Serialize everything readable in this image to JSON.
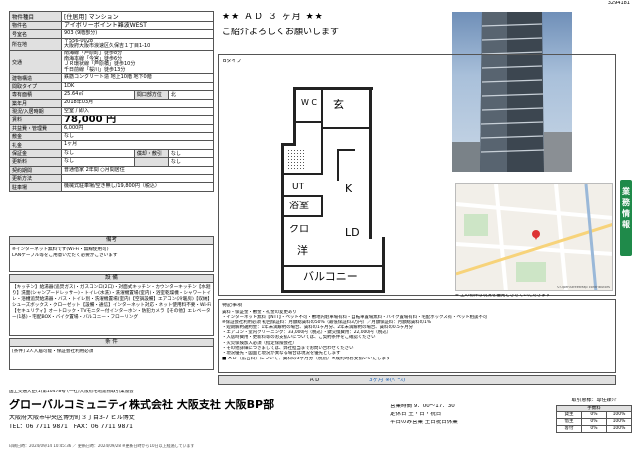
{
  "doc_number": "3294181",
  "header": {
    "category_label": "物件種目",
    "category_value": "[住居用] マンション",
    "tagline": "★★ ＡＤ ３ ヶ月 ★★",
    "greeting": "ご紹介よろしくお願いします"
  },
  "property_rows": [
    {
      "k": "物件名",
      "v": "アイボリーポイント難波WEST"
    },
    {
      "k": "号室名",
      "v": "903 (9階部分)"
    },
    {
      "k": "所在地",
      "v": "〒556-0028\n大阪府大阪市浪速区久保吉１丁目1-10"
    },
    {
      "k": "交通",
      "v": "南海線「芦原町」徒歩8分\n南海本線「今宮」徒歩6分\nＪＲ環状線「芦原橋」徒歩10分\n千日前線「桜川」徒歩13分"
    },
    {
      "k": "建物構造",
      "v": "鉄筋コンクリート造 地上10階 地下0階"
    },
    {
      "k": "間取タイプ",
      "v": "1DK"
    },
    {
      "k": "専有面積",
      "v": "25.64㎡",
      "k2": "間口部方位",
      "v2": "北"
    },
    {
      "k": "築年月",
      "v": "2018年03月"
    },
    {
      "k": "現況/入居時期",
      "v": "空室 / 即入"
    },
    {
      "k": "賃料",
      "v": "78,000 円"
    },
    {
      "k": "共益費・管理費",
      "v": "6,000円"
    },
    {
      "k": "敷金",
      "v": "なし"
    },
    {
      "k": "礼金",
      "v": "1ヶ月"
    },
    {
      "k": "保証金",
      "v": "なし",
      "k2": "償却・敷引",
      "v2": "なし"
    },
    {
      "k": "更新料",
      "v": "なし",
      "k2": "",
      "v2": "なし"
    },
    {
      "k": "契約期間",
      "v": "普通借家 2年間 ○月間居住"
    },
    {
      "k": "更新方法",
      "v": ""
    },
    {
      "k": "駐車場",
      "v": "機械式駐車場/空き無し/19,800円（税込）"
    }
  ],
  "remarks": {
    "label": "備考",
    "lines": [
      "※インターネット無料です(Wi-Fi・無線使用可)",
      "LANケーブル等をご用意いただく必要がございます"
    ]
  },
  "facilities": {
    "label": "設 備",
    "text": "【キッチン】給湯器(追焚ガス)・ガスコンロ(2口)・対面式キッチン・カウンターキッチン【水廻り】洗面(シャンプードレッサー)・トイレ(水洗)・洗濯機置場(室内)・浴室乾燥機・シャワートイレ・浴槽追焚給湯器・バス・トイレ別・洗濯機置場(室内)【空調設備】エアコン(冷暖房)【収納】シューズボックス・クローゼット【設備・通信】インターネット対応・ネット使用料不要・Wi-Fi【セキュリティ】オートロック・TVモニター付インターホン・防犯カメラ【その他】エレベーター(1基)・宅配BOX・バイク置場・バルコニー・フローリング"
  },
  "conditions": {
    "label": "条 件",
    "text": "[条件] 2人入居可能・保証会社利用必須"
  },
  "floorplan": {
    "type_label": "Bタイプ",
    "rooms": {
      "wc": "W C",
      "entry": "玄",
      "ut": "UT",
      "k": "K",
      "bath": "浴室",
      "closet": "クロ",
      "ld": "LD",
      "western": "洋",
      "balcony": "バルコニー"
    },
    "caption": "※ 上の物件は現況を優先とさせていただきます"
  },
  "side_tab": "業務情報",
  "notes": {
    "label": "特記事項",
    "lines": [
      "賃料・保証金・敷金・礼金の変更あり",
      "・インターネット無料【NTT】・ペット不可・敷地内駐車場有料・自転車置場無料・バイク置場有料・宅配ボックス有・ペット相談不可",
      "※保証会社利用必須 初回保証料：月額総賃料の50%（最低保証料3万円）／月額保証料：月額総賃料の1%",
      "・短期解約違約金：1年未満解約の場合、賃料の1ヶ月分、2年未満解約の場合、賃料の0.5ヶ月分",
      "・エアコン・室内クリーニング：33,000円（税込）・鍵交換費用：22,000円（税込）",
      "・入居時費用・更新料等のお支払いについては、ご契約条件をご確認ください",
      "・火災保険加入必須（指定保険会社）",
      "・その他詳細につきましては、弊社担当までお問い合わせください",
      "・現況優先・図面と現況が異なる場合は現況を優先とします"
    ],
    "commission": "■ ＡＤ（広告料）について：賃料の3ヶ月分（税別）※成約時お支払いいたします",
    "ad_label": "ＡＤ",
    "ad_value": "3ヶ月 ※(ﾍﾞｰｽ)"
  },
  "footer": {
    "license": "国土交通大臣(1)第10478号 (一社)大阪府宅地建物取引業協会",
    "company": "グローバルコミュニティ株式会社 大阪支社 大阪BP部",
    "address": "大阪府大阪市中央区博労町３丁目3-7 ビル博丈",
    "tel": "TEL：06 7711 9871　FAX：06 7711 9871",
    "hours": "営業時間 9：00〜17：30",
    "hours2": "定休日 土・日・祝日",
    "update": "平日のみ営業 土日祝日休業",
    "print_info": "印刷日時：2024/09/14 10:45:36 ／ 更新日時：2024/09/28 ※更新日時から10日以上経過しています",
    "status_box": {
      "title": "取引態様：専任媒介",
      "header": "手数料",
      "rows": [
        [
          "貸主",
          "0%",
          "100%"
        ],
        [
          "借主",
          "0%",
          "100%"
        ],
        [
          "客付",
          "0%",
          "100%"
        ]
      ]
    }
  },
  "map_credit": "©OpenStreetMap contributors"
}
